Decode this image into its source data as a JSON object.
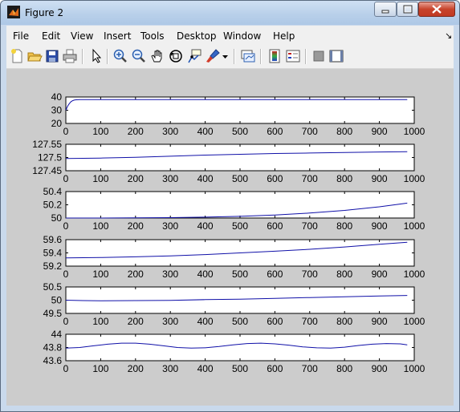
{
  "window": {
    "title": "Figure 2"
  },
  "menu": [
    "File",
    "Edit",
    "View",
    "Insert",
    "Tools",
    "Desktop",
    "Window",
    "Help"
  ],
  "menu_arrow": "↘",
  "toolbar_icons": [
    "new-figure-icon",
    "open-file-icon",
    "save-icon",
    "print-icon",
    "pointer-icon",
    "zoom-in-icon",
    "zoom-out-icon",
    "pan-hand-icon",
    "rotate-3d-icon",
    "data-cursor-icon",
    "brush-icon",
    "brush-dropdown-icon",
    "link-plot-icon",
    "colorbar-icon",
    "legend-icon",
    "hide-plot-tools-icon",
    "show-plot-tools-icon"
  ],
  "colors": {
    "curve": "#1010a8",
    "figure_bg": "#cccccc",
    "title_bar": "#b9d0ea",
    "close_button": "#c7432b"
  },
  "chart_data": [
    {
      "type": "line",
      "xlim": [
        0,
        1000
      ],
      "ylim": [
        20,
        40
      ],
      "xticks": [
        "0",
        "100",
        "200",
        "300",
        "400",
        "500",
        "600",
        "700",
        "800",
        "900",
        "1000"
      ],
      "yticks": [
        "40",
        "30",
        "20"
      ],
      "series": [
        {
          "x": [
            0,
            5,
            10,
            15,
            20,
            25,
            30,
            40,
            60,
            100,
            200,
            400,
            600,
            800,
            980
          ],
          "y": [
            30,
            33,
            35,
            36.5,
            37.3,
            37.7,
            37.9,
            38,
            38,
            38,
            38,
            38,
            38,
            38,
            38
          ]
        }
      ]
    },
    {
      "type": "line",
      "xlim": [
        0,
        1000
      ],
      "ylim": [
        127.45,
        127.55
      ],
      "xticks": [
        "0",
        "100",
        "200",
        "300",
        "400",
        "500",
        "600",
        "700",
        "800",
        "900",
        "1000"
      ],
      "yticks": [
        "127.55",
        "127.5",
        "127.45"
      ],
      "series": [
        {
          "x": [
            0,
            100,
            200,
            300,
            400,
            500,
            600,
            700,
            800,
            900,
            980
          ],
          "y": [
            127.496,
            127.498,
            127.501,
            127.505,
            127.509,
            127.512,
            127.515,
            127.517,
            127.519,
            127.521,
            127.522
          ]
        }
      ]
    },
    {
      "type": "line",
      "xlim": [
        0,
        1000
      ],
      "ylim": [
        50,
        50.4
      ],
      "xticks": [
        "0",
        "100",
        "200",
        "300",
        "400",
        "500",
        "600",
        "700",
        "800",
        "900",
        "1000"
      ],
      "yticks": [
        "50.4",
        "50.2",
        "50"
      ],
      "series": [
        {
          "x": [
            0,
            100,
            200,
            300,
            400,
            500,
            600,
            700,
            800,
            900,
            980
          ],
          "y": [
            50.0,
            50.0,
            50.002,
            50.006,
            50.013,
            50.025,
            50.045,
            50.075,
            50.115,
            50.17,
            50.225
          ]
        }
      ]
    },
    {
      "type": "line",
      "xlim": [
        0,
        1000
      ],
      "ylim": [
        59.2,
        59.6
      ],
      "xticks": [
        "0",
        "100",
        "200",
        "300",
        "400",
        "500",
        "600",
        "700",
        "800",
        "900",
        "1000"
      ],
      "yticks": [
        "59.6",
        "59.4",
        "59.2"
      ],
      "series": [
        {
          "x": [
            0,
            100,
            200,
            300,
            400,
            500,
            600,
            700,
            800,
            900,
            980
          ],
          "y": [
            59.325,
            59.33,
            59.34,
            59.355,
            59.375,
            59.4,
            59.425,
            59.455,
            59.49,
            59.53,
            59.56
          ]
        }
      ]
    },
    {
      "type": "line",
      "xlim": [
        0,
        1000
      ],
      "ylim": [
        49.5,
        50.5
      ],
      "xticks": [
        "0",
        "100",
        "200",
        "300",
        "400",
        "500",
        "600",
        "700",
        "800",
        "900",
        "1000"
      ],
      "yticks": [
        "50.5",
        "50",
        "49.5"
      ],
      "series": [
        {
          "x": [
            0,
            50,
            100,
            200,
            300,
            400,
            500,
            600,
            700,
            800,
            900,
            980
          ],
          "y": [
            50.0,
            49.985,
            49.98,
            49.985,
            49.995,
            50.02,
            50.04,
            50.07,
            50.1,
            50.13,
            50.16,
            50.18
          ]
        }
      ]
    },
    {
      "type": "line",
      "xlim": [
        0,
        1000
      ],
      "ylim": [
        43.6,
        44
      ],
      "xticks": [
        "0",
        "100",
        "200",
        "300",
        "400",
        "500",
        "600",
        "700",
        "800",
        "900",
        "1000"
      ],
      "yticks": [
        "44",
        "43.8",
        "43.6"
      ],
      "series": [
        {
          "x": [
            0,
            40,
            80,
            120,
            160,
            200,
            240,
            280,
            320,
            360,
            400,
            440,
            480,
            520,
            560,
            600,
            640,
            680,
            720,
            760,
            800,
            840,
            880,
            920,
            960,
            980
          ],
          "y": [
            43.79,
            43.8,
            43.825,
            43.85,
            43.865,
            43.865,
            43.85,
            43.825,
            43.8,
            43.79,
            43.795,
            43.815,
            43.84,
            43.86,
            43.865,
            43.855,
            43.835,
            43.81,
            43.795,
            43.79,
            43.805,
            43.83,
            43.85,
            43.86,
            43.855,
            43.84
          ]
        }
      ]
    }
  ]
}
